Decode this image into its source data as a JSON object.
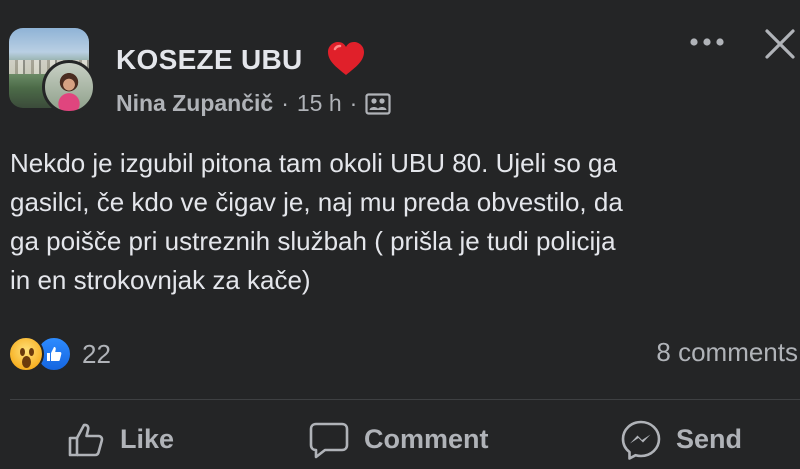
{
  "post": {
    "group_name": "KOSEZE UBU",
    "author": "Nina Zupančič",
    "time": "15 h",
    "separator": "·",
    "text_lines": [
      "Nekdo je izgubil pitona tam okoli UBU 80. Ujeli so ga",
      "gasilci, če kdo ve čigav je, naj mu preda obvestilo, da",
      "ga poišče pri ustreznih službah ( prišla je tudi policija",
      "in en strokovnjak za kače)"
    ]
  },
  "reactions": {
    "count": "22",
    "icons": [
      "wow-icon",
      "like-reaction-icon"
    ]
  },
  "comments": {
    "label": "8 comments"
  },
  "actions": {
    "like_label": "Like",
    "comment_label": "Comment",
    "send_label": "Send"
  },
  "icons": {
    "heart": "heart-icon",
    "privacy": "group-members-icon",
    "more": "more-dots-icon",
    "close": "close-icon"
  },
  "colors": {
    "background": "#242526",
    "primary_text": "#e4e6eb",
    "secondary_text": "#b0b3b8",
    "heart": "#e0202a",
    "like_blue": "#1877f2",
    "divider": "#3e4042"
  }
}
